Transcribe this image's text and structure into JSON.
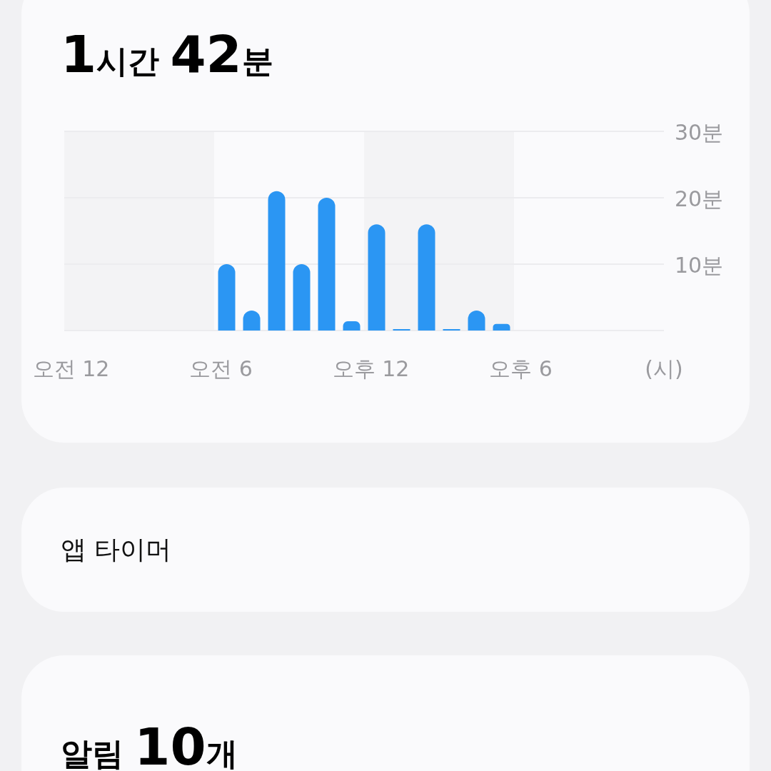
{
  "screen_time": {
    "total": "1시간 42분",
    "chart_data": {
      "type": "bar",
      "categories": [
        "오전 12",
        null,
        null,
        null,
        null,
        null,
        "오전 6",
        null,
        null,
        null,
        null,
        null,
        "오후 12",
        null,
        null,
        null,
        null,
        null,
        "오후 6",
        null,
        null,
        null,
        null,
        null
      ],
      "series": [
        {
          "color": "#2b96f3",
          "values": [
            0,
            0,
            0,
            0,
            0,
            0,
            10,
            3,
            21,
            10,
            20,
            1.4,
            16,
            0.2,
            16,
            0.1,
            3,
            1,
            0,
            0,
            0,
            0,
            0,
            0
          ]
        }
      ],
      "ylim": [
        0,
        30
      ],
      "yticks": [
        {
          "value": 10,
          "label": "10분"
        },
        {
          "value": 20,
          "label": "20분"
        },
        {
          "value": 30,
          "label": "30분"
        }
      ],
      "xlabel": "(시)"
    }
  },
  "app_timer": {
    "label": "앱 타이머"
  },
  "notifications": {
    "total": "알림 10개"
  }
}
